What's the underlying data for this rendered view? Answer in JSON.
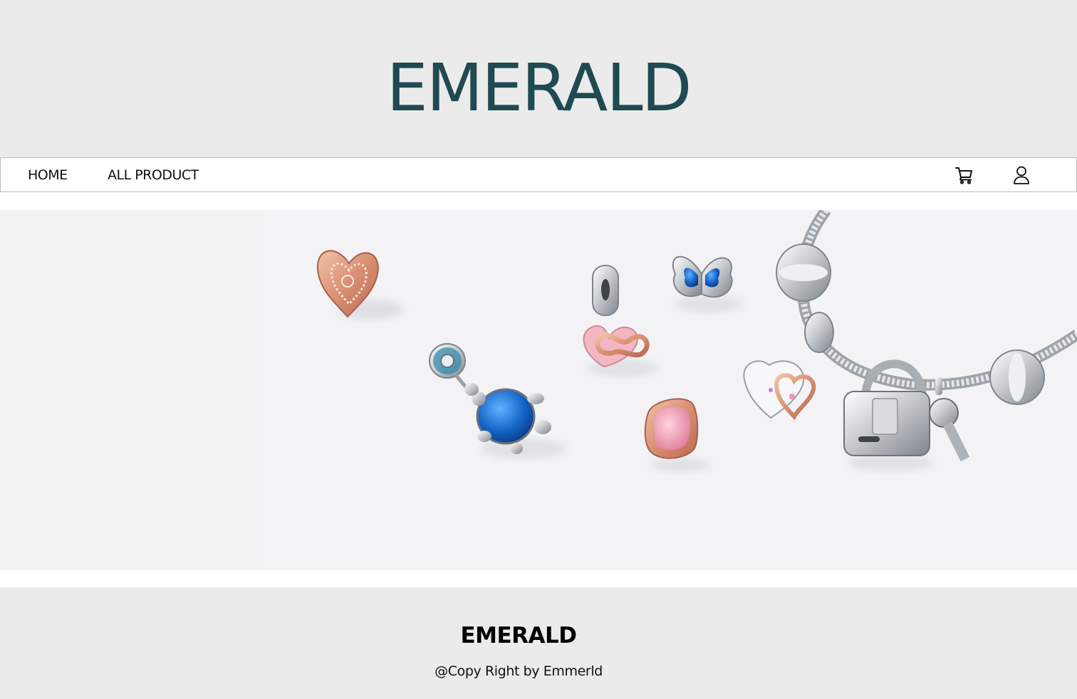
{
  "header": {
    "brand_title": "EMERALD",
    "brand_color": "#1f4a52"
  },
  "nav": {
    "home_label": "HOME",
    "all_products_label": "ALL PRODUCT",
    "cart_icon": "cart-icon",
    "user_icon": "user-icon"
  },
  "hero": {
    "image_description_icons": [
      "heart-charm",
      "turtle-charm",
      "infinity-heart-charm",
      "butterfly-charm",
      "pink-clip-charm",
      "padlock-charm",
      "key-charm",
      "snake-chain-bracelet"
    ]
  },
  "footer": {
    "title": "EMERALD",
    "copyright": "@Copy Right by Emmerld"
  }
}
